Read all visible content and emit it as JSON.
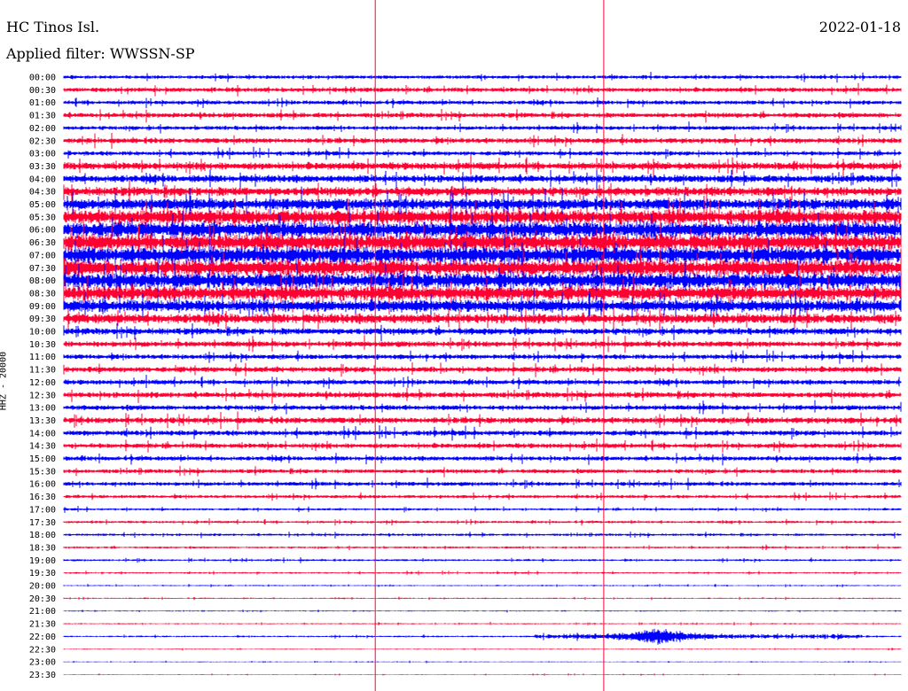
{
  "header": {
    "station": "HC Tinos Isl.",
    "date": "2022-01-18",
    "filter": "Applied filter: WWSSN-SP"
  },
  "chart_data": {
    "type": "line",
    "title": "HC Tinos Isl.",
    "subtitle": "Applied filter: WWSSN-SP",
    "ylabel": "HHZ - 20000",
    "xlabel": "",
    "grid": false,
    "legend": "none",
    "colors": {
      "even_rows": "#0000ff",
      "odd_rows": "#ff0033",
      "markers": "#ff0033"
    },
    "row_labels": [
      "00:00",
      "00:30",
      "01:00",
      "01:30",
      "02:00",
      "02:30",
      "03:00",
      "03:30",
      "04:00",
      "04:30",
      "05:00",
      "05:30",
      "06:00",
      "06:30",
      "07:00",
      "07:30",
      "08:00",
      "08:30",
      "09:00",
      "09:30",
      "10:00",
      "10:30",
      "11:00",
      "11:30",
      "12:00",
      "12:30",
      "13:00",
      "13:30",
      "14:00",
      "14:30",
      "15:00",
      "15:30",
      "16:00",
      "16:30",
      "17:00",
      "17:30",
      "18:00",
      "18:30",
      "19:00",
      "19:30",
      "20:00",
      "20:30",
      "21:00",
      "21:30",
      "22:00",
      "22:30",
      "23:00",
      "23:30"
    ],
    "relative_amplitude": [
      0.45,
      0.55,
      0.5,
      0.6,
      0.5,
      0.65,
      0.55,
      0.9,
      0.9,
      1.1,
      1.4,
      1.8,
      2.0,
      2.0,
      2.0,
      2.0,
      1.9,
      1.8,
      1.5,
      1.2,
      0.8,
      0.7,
      0.6,
      0.7,
      0.6,
      0.7,
      0.6,
      0.75,
      0.65,
      0.6,
      0.55,
      0.5,
      0.5,
      0.4,
      0.3,
      0.3,
      0.3,
      0.25,
      0.25,
      0.2,
      0.15,
      0.15,
      0.12,
      0.15,
      0.2,
      0.12,
      0.1,
      0.1
    ],
    "x_markers_fraction": [
      0.372,
      0.645
    ],
    "events": [
      {
        "row_label": "22:00",
        "x_fraction": 0.71,
        "amplitude": 1.8
      }
    ]
  }
}
